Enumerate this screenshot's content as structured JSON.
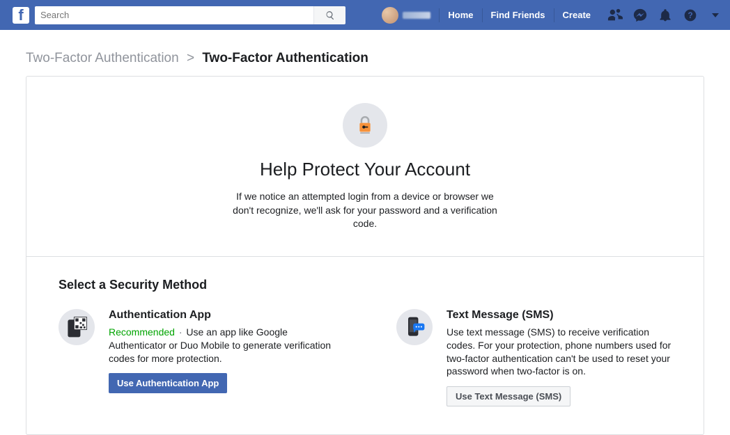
{
  "nav": {
    "search_placeholder": "Search",
    "links": {
      "home": "Home",
      "find_friends": "Find Friends",
      "create": "Create"
    }
  },
  "breadcrumb": {
    "parent": "Two-Factor Authentication",
    "separator": ">",
    "current": "Two-Factor Authentication"
  },
  "hero": {
    "title": "Help Protect Your Account",
    "description": "If we notice an attempted login from a device or browser we don't recognize, we'll ask for your password and a verification code."
  },
  "methods": {
    "heading": "Select a Security Method",
    "app": {
      "title": "Authentication App",
      "recommended": "Recommended",
      "description": "Use an app like Google Authenticator or Duo Mobile to generate verification codes for more protection.",
      "button": "Use Authentication App"
    },
    "sms": {
      "title": "Text Message (SMS)",
      "description": "Use text message (SMS) to receive verification codes. For your protection, phone numbers used for two-factor authentication can't be used to reset your password when two-factor is on.",
      "button": "Use Text Message (SMS)"
    }
  },
  "colors": {
    "brand": "#4267b2",
    "recommended": "#00a400"
  }
}
